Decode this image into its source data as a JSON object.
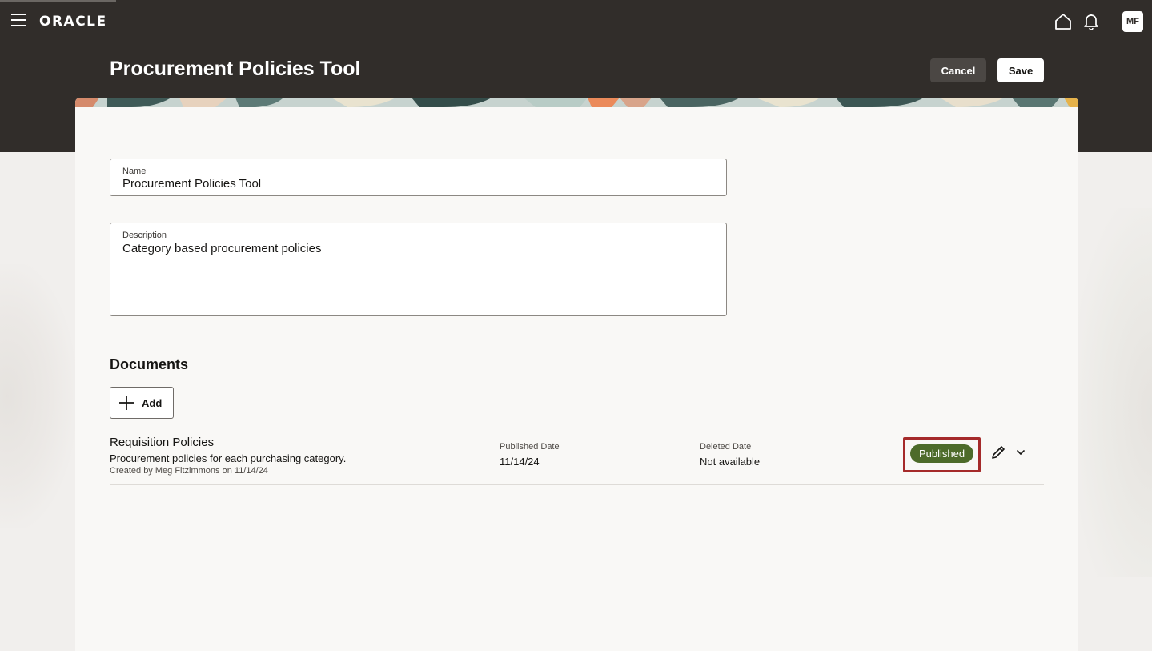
{
  "header": {
    "logo_text": "ORACLE",
    "avatar_initials": "MF"
  },
  "page": {
    "title": "Procurement Policies Tool",
    "cancel_label": "Cancel",
    "save_label": "Save"
  },
  "form": {
    "name_label": "Name",
    "name_value": "Procurement Policies Tool",
    "description_label": "Description",
    "description_value": "Category based procurement policies"
  },
  "documents": {
    "section_title": "Documents",
    "add_label": "Add",
    "items": [
      {
        "title": "Requisition Policies",
        "description": "Procurement policies for each purchasing category.",
        "created": "Created by Meg Fitzimmons on 11/14/24",
        "published_label": "Published Date",
        "published_value": "11/14/24",
        "deleted_label": "Deleted Date",
        "deleted_value": "Not available",
        "status": "Published"
      }
    ]
  },
  "icons": {
    "menu": "hamburger-menu-icon",
    "home": "home-icon",
    "notifications": "bell-icon",
    "add": "plus-icon",
    "edit": "pencil-icon",
    "expand": "chevron-down-icon"
  },
  "colors": {
    "header_bg": "#312d2a",
    "status_published": "#4d6b2a",
    "highlight": "#a52a2a"
  }
}
